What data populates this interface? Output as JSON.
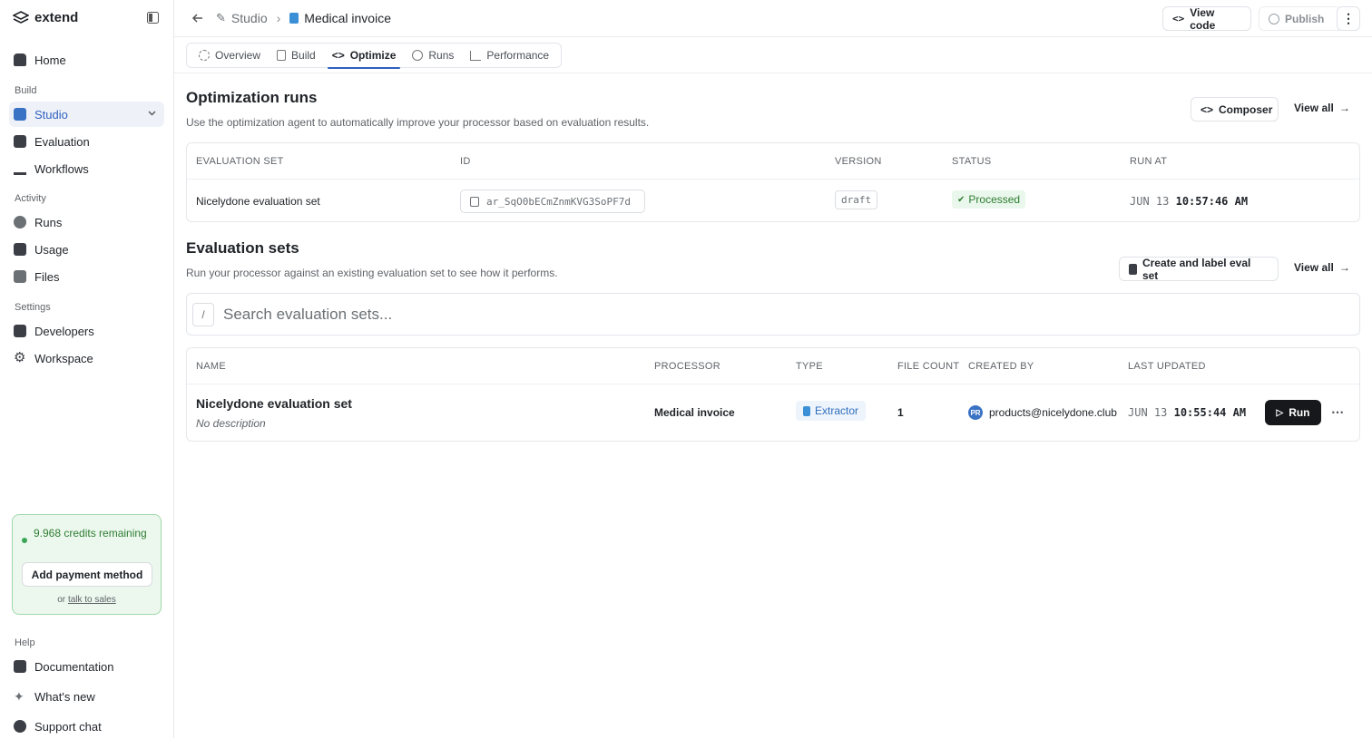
{
  "sidebar": {
    "logo": "extend",
    "home": "Home",
    "build_label": "Build",
    "studio": "Studio",
    "evaluation": "Evaluation",
    "workflows": "Workflows",
    "activity_label": "Activity",
    "runs": "Runs",
    "usage": "Usage",
    "files": "Files",
    "settings_label": "Settings",
    "developers": "Developers",
    "workspace": "Workspace",
    "credits": "9.968 credits remaining",
    "add_payment": "Add payment method",
    "or": "or",
    "talk_to_sales": "talk to sales",
    "help_label": "Help",
    "documentation": "Documentation",
    "whats_new": "What's new",
    "support_chat": "Support chat"
  },
  "topbar": {
    "crumb_studio": "Studio",
    "crumb_processor": "Medical invoice",
    "view_code": "View code",
    "publish": "Publish"
  },
  "tabs": [
    "Overview",
    "Build",
    "Optimize",
    "Runs",
    "Performance"
  ],
  "optimization": {
    "title": "Optimization runs",
    "subtitle": "Use the optimization agent to automatically improve your processor based on evaluation results.",
    "composer": "Composer",
    "view_all": "View all",
    "headers": [
      "EVALUATION SET",
      "ID",
      "VERSION",
      "STATUS",
      "RUN AT"
    ],
    "row": {
      "eval_set": "Nicelydone evaluation set",
      "id": "ar_SqO0bECmZnmKVG3SoPF7d",
      "version": "draft",
      "status": "Processed",
      "run_date": "JUN 13",
      "run_time": "10:57:46 AM"
    }
  },
  "evaluation_sets": {
    "title": "Evaluation sets",
    "subtitle": "Run your processor against an existing evaluation set to see how it performs.",
    "create": "Create and label eval set",
    "view_all": "View all",
    "search_key": "/",
    "search_placeholder": "Search evaluation sets...",
    "headers": [
      "NAME",
      "PROCESSOR",
      "TYPE",
      "FILE COUNT",
      "CREATED BY",
      "LAST UPDATED"
    ],
    "row": {
      "name": "Nicelydone evaluation set",
      "description": "No description",
      "processor": "Medical invoice",
      "type": "Extractor",
      "file_count": "1",
      "avatar": "PR",
      "created_by": "products@nicelydone.club",
      "updated_date": "JUN 13",
      "updated_time": "10:55:44 AM",
      "run": "Run"
    }
  }
}
